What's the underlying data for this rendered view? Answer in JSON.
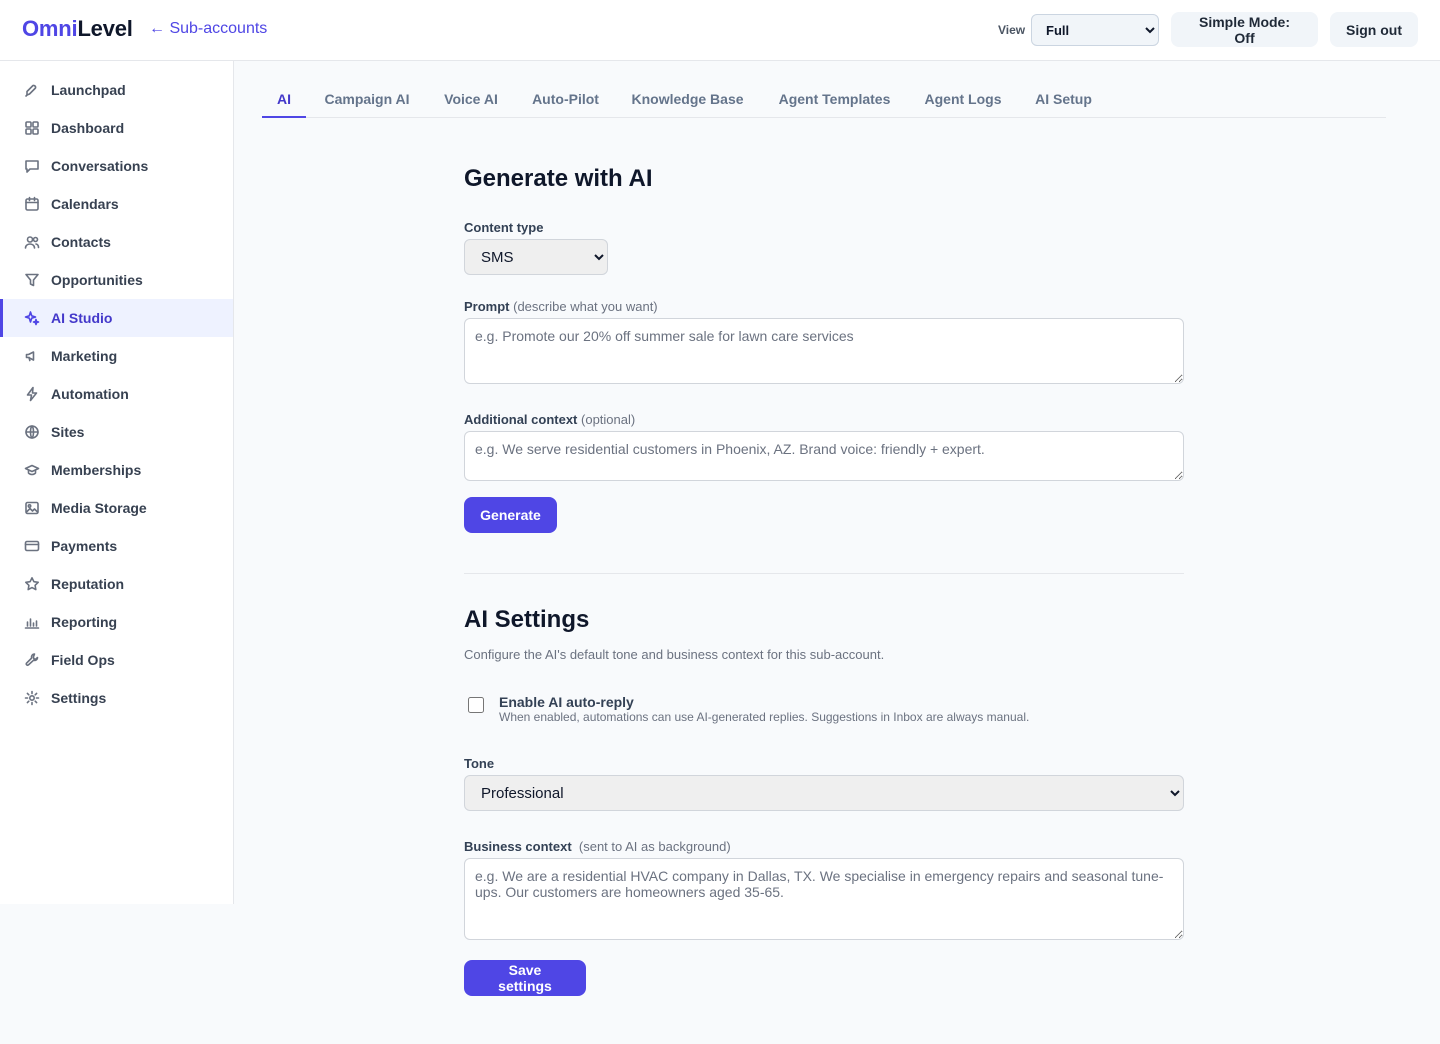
{
  "header": {
    "brand_part1": "Omni",
    "brand_part2": "Level",
    "back_link": "← Sub-accounts",
    "view_label": "View",
    "view_selected": "Full",
    "simple_mode": "Simple Mode: Off",
    "sign_out": "Sign out"
  },
  "sidebar": {
    "items": [
      {
        "label": "Launchpad",
        "icon": "rocket-icon"
      },
      {
        "label": "Dashboard",
        "icon": "grid-icon"
      },
      {
        "label": "Conversations",
        "icon": "chat-icon"
      },
      {
        "label": "Calendars",
        "icon": "calendar-icon"
      },
      {
        "label": "Contacts",
        "icon": "users-icon"
      },
      {
        "label": "Opportunities",
        "icon": "funnel-icon"
      },
      {
        "label": "AI Studio",
        "icon": "sparkle-icon",
        "active": true
      },
      {
        "label": "Marketing",
        "icon": "megaphone-icon"
      },
      {
        "label": "Automation",
        "icon": "bolt-icon"
      },
      {
        "label": "Sites",
        "icon": "globe-icon"
      },
      {
        "label": "Memberships",
        "icon": "graduation-cap-icon"
      },
      {
        "label": "Media Storage",
        "icon": "image-icon"
      },
      {
        "label": "Payments",
        "icon": "credit-card-icon"
      },
      {
        "label": "Reputation",
        "icon": "star-icon"
      },
      {
        "label": "Reporting",
        "icon": "bar-chart-icon"
      },
      {
        "label": "Field Ops",
        "icon": "wrench-icon"
      },
      {
        "label": "Settings",
        "icon": "gear-icon"
      }
    ]
  },
  "tabs": [
    {
      "label": "AI",
      "active": true
    },
    {
      "label": "Campaign AI"
    },
    {
      "label": "Voice AI"
    },
    {
      "label": "Auto-Pilot"
    },
    {
      "label": "Knowledge Base"
    },
    {
      "label": "Agent Templates"
    },
    {
      "label": "Agent Logs"
    },
    {
      "label": "AI Setup"
    }
  ],
  "generate": {
    "title": "Generate with AI",
    "content_type_label": "Content type",
    "content_type_value": "SMS",
    "prompt_label": "Prompt",
    "prompt_hint": "(describe what you want)",
    "prompt_placeholder": "e.g. Promote our 20% off summer sale for lawn care services",
    "context_label": "Additional context",
    "context_hint": "(optional)",
    "context_placeholder": "e.g. We serve residential customers in Phoenix, AZ. Brand voice: friendly + expert.",
    "generate_button": "Generate"
  },
  "settings": {
    "title": "AI Settings",
    "subtitle": "Configure the AI's default tone and business context for this sub-account.",
    "auto_reply_label": "Enable AI auto-reply",
    "auto_reply_desc": "When enabled, automations can use AI-generated replies. Suggestions in Inbox are always manual.",
    "auto_reply_checked": false,
    "tone_label": "Tone",
    "tone_value": "Professional",
    "business_label": "Business context",
    "business_hint": "(sent to AI as background)",
    "business_placeholder": "e.g. We are a residential HVAC company in Dallas, TX. We specialise in emergency repairs and seasonal tune-ups. Our customers are homeowners aged 35-65.",
    "save_button": "Save settings"
  },
  "colors": {
    "accent": "#4f46e5",
    "accent_bg": "#eef2ff"
  }
}
